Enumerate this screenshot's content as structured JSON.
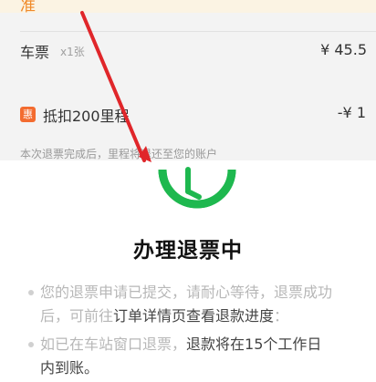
{
  "top_band": {
    "text": "准"
  },
  "ticket": {
    "label": "车票",
    "qty": "x1张",
    "price": "¥ 45.5"
  },
  "discount": {
    "badge": "惠",
    "label": "抵扣200里程",
    "amount": "-¥ 1"
  },
  "refund_note": "本次退票完成后，里程将退还至您的账户",
  "status": {
    "title": "办理退票中",
    "line1": "您的退票申请已提交，请耐心等待，退票成功",
    "line2_pre": "后，可前往",
    "line2_link": "订单详情页查看退款进度",
    "line2_post": "：",
    "line3_pre": "如已在车站窗口退票，",
    "line3_hl": "退款将在15个工作日",
    "line4": "内到账。"
  },
  "colors": {
    "accent_green": "#1eb84f",
    "discount_orange": "#f36b2f",
    "annotation_red": "#e0262a"
  },
  "icons": {
    "status_icon": "clock-icon"
  }
}
